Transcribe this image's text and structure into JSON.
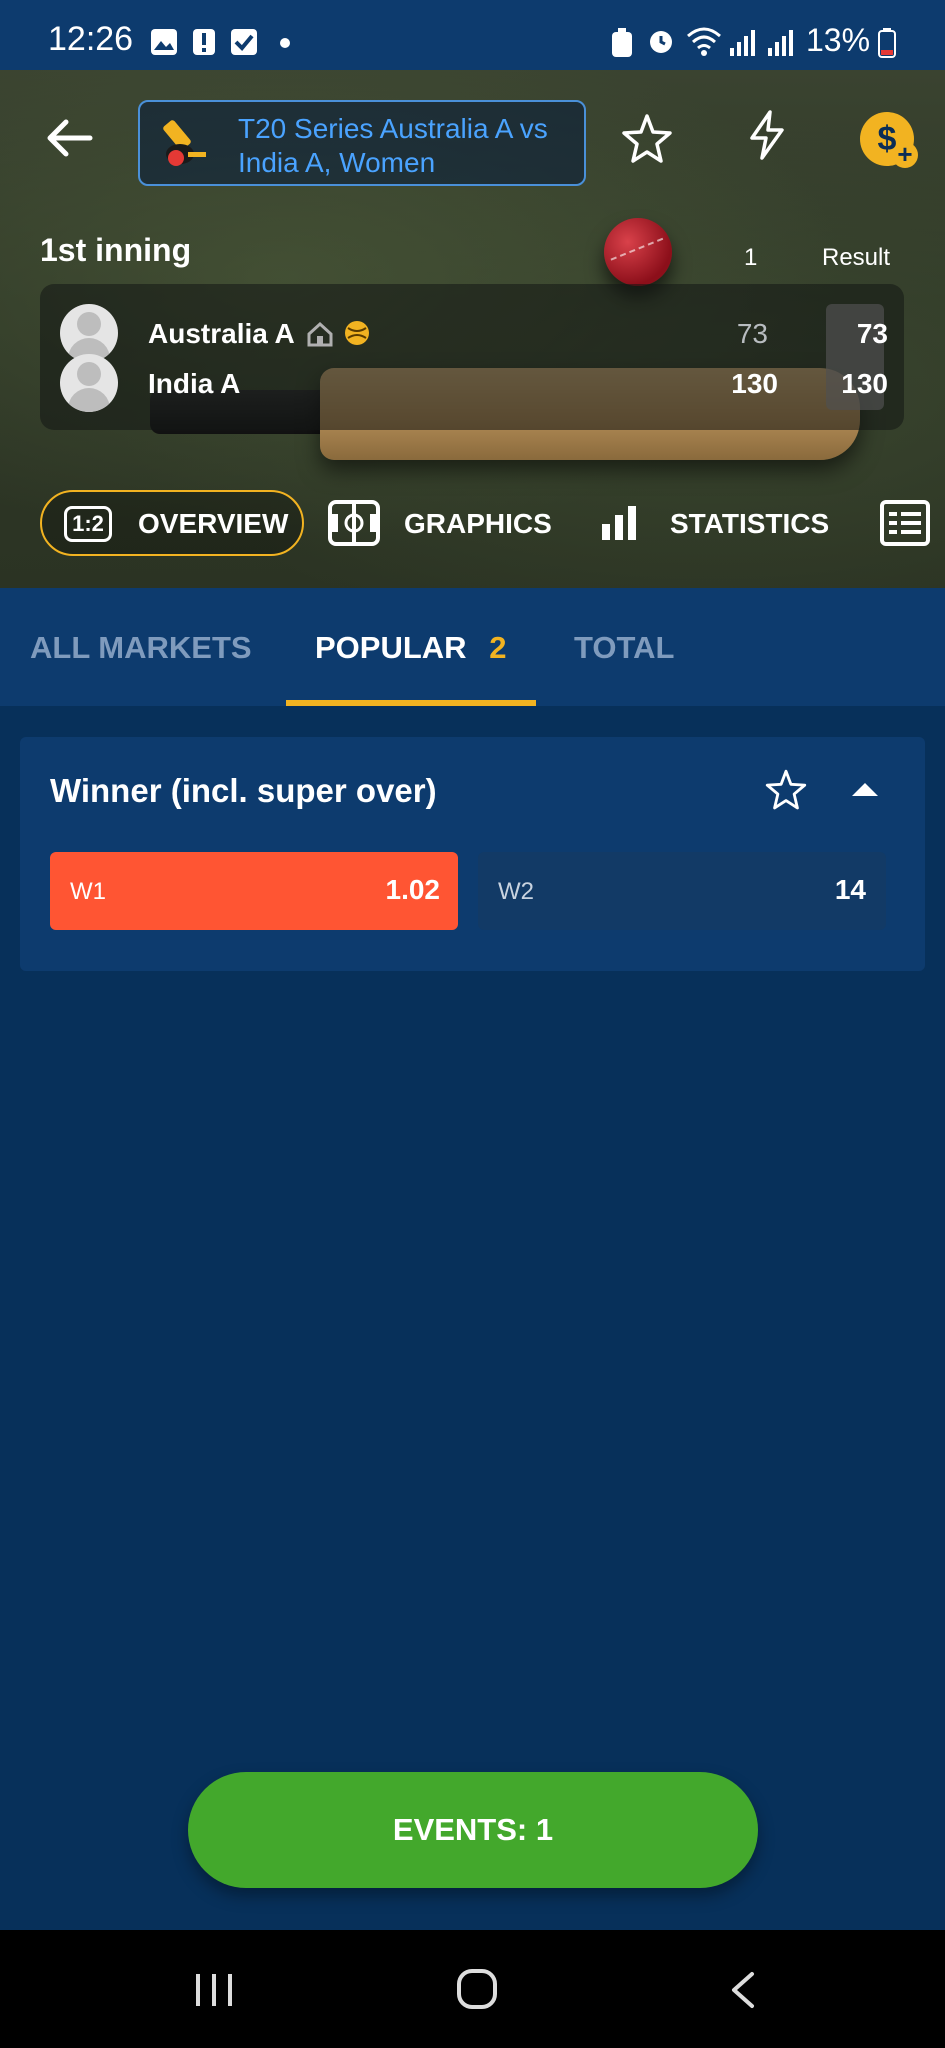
{
  "status_bar": {
    "time": "12:26",
    "battery": "13%"
  },
  "header": {
    "title": "T20 Series Australia A vs India A, Women",
    "coin_symbol": "$"
  },
  "scoreboard": {
    "inning_label": "1st inning",
    "col_innings": "1",
    "col_result": "Result",
    "teams": [
      {
        "name": "Australia A",
        "innings_score": "73",
        "result": "73"
      },
      {
        "name": "India A",
        "innings_score": "130",
        "result": "130"
      }
    ]
  },
  "view_chips": {
    "score_badge": "1:2",
    "overview": "OVERVIEW",
    "graphics": "GRAPHICS",
    "statistics": "STATISTICS"
  },
  "market_tabs": {
    "all": "ALL MARKETS",
    "popular": "POPULAR",
    "popular_count": "2",
    "total": "TOTAL"
  },
  "market": {
    "title": "Winner (incl. super over)",
    "w1_label": "W1",
    "w1_value": "1.02",
    "w2_label": "W2",
    "w2_value": "14"
  },
  "events_button": "EVENTS: 1",
  "colors": {
    "accent_yellow": "#f2b321",
    "selected_odd": "#ff5533",
    "events_green": "#43a82c",
    "background": "#07305a"
  }
}
